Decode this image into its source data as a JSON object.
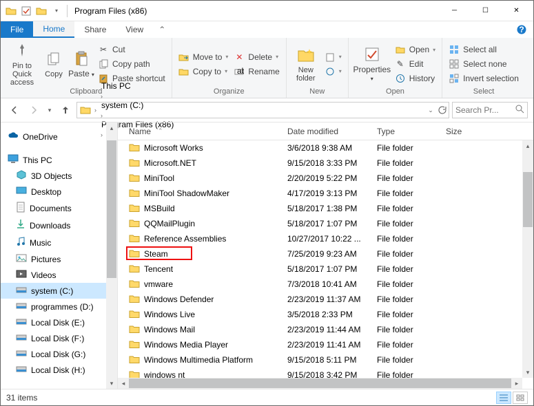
{
  "title": "Program Files (x86)",
  "tabs": {
    "file": "File",
    "home": "Home",
    "share": "Share",
    "view": "View"
  },
  "ribbon": {
    "pin": "Pin to Quick access",
    "copy": "Copy",
    "paste": "Paste",
    "cut": "Cut",
    "copypath": "Copy path",
    "pastesc": "Paste shortcut",
    "clipboard": "Clipboard",
    "moveto": "Move to",
    "copyto": "Copy to",
    "delete": "Delete",
    "rename": "Rename",
    "organize": "Organize",
    "newfolder": "New folder",
    "new": "New",
    "properties": "Properties",
    "open": "Open",
    "edit": "Edit",
    "history": "History",
    "open_g": "Open",
    "selectall": "Select all",
    "selectnone": "Select none",
    "invert": "Invert selection",
    "select_g": "Select"
  },
  "breadcrumbs": [
    "This PC",
    "system (C:)",
    "Program Files (x86)"
  ],
  "search_placeholder": "Search Pr...",
  "cols": {
    "name": "Name",
    "date": "Date modified",
    "type": "Type",
    "size": "Size"
  },
  "nav": {
    "onedrive": "OneDrive",
    "thispc": "This PC",
    "children": [
      "3D Objects",
      "Desktop",
      "Documents",
      "Downloads",
      "Music",
      "Pictures",
      "Videos",
      "system (C:)",
      "programmes (D:)",
      "Local Disk (E:)",
      "Local Disk (F:)",
      "Local Disk (G:)",
      "Local Disk (H:)"
    ]
  },
  "files": [
    {
      "name": "Microsoft Works",
      "date": "3/6/2018 9:38 AM",
      "type": "File folder"
    },
    {
      "name": "Microsoft.NET",
      "date": "9/15/2018 3:33 PM",
      "type": "File folder"
    },
    {
      "name": "MiniTool",
      "date": "2/20/2019 5:22 PM",
      "type": "File folder"
    },
    {
      "name": "MiniTool ShadowMaker",
      "date": "4/17/2019 3:13 PM",
      "type": "File folder"
    },
    {
      "name": "MSBuild",
      "date": "5/18/2017 1:38 PM",
      "type": "File folder"
    },
    {
      "name": "QQMailPlugin",
      "date": "5/18/2017 1:07 PM",
      "type": "File folder"
    },
    {
      "name": "Reference Assemblies",
      "date": "10/27/2017 10:22 ...",
      "type": "File folder"
    },
    {
      "name": "Steam",
      "date": "7/25/2019 9:23 AM",
      "type": "File folder",
      "highlight": true
    },
    {
      "name": "Tencent",
      "date": "5/18/2017 1:07 PM",
      "type": "File folder"
    },
    {
      "name": "vmware",
      "date": "7/3/2018 10:41 AM",
      "type": "File folder"
    },
    {
      "name": "Windows Defender",
      "date": "2/23/2019 11:37 AM",
      "type": "File folder"
    },
    {
      "name": "Windows Live",
      "date": "3/5/2018 2:33 PM",
      "type": "File folder"
    },
    {
      "name": "Windows Mail",
      "date": "2/23/2019 11:44 AM",
      "type": "File folder"
    },
    {
      "name": "Windows Media Player",
      "date": "2/23/2019 11:41 AM",
      "type": "File folder"
    },
    {
      "name": "Windows Multimedia Platform",
      "date": "9/15/2018 5:11 PM",
      "type": "File folder"
    },
    {
      "name": "windows nt",
      "date": "9/15/2018 3:42 PM",
      "type": "File folder"
    }
  ],
  "status": "31 items"
}
